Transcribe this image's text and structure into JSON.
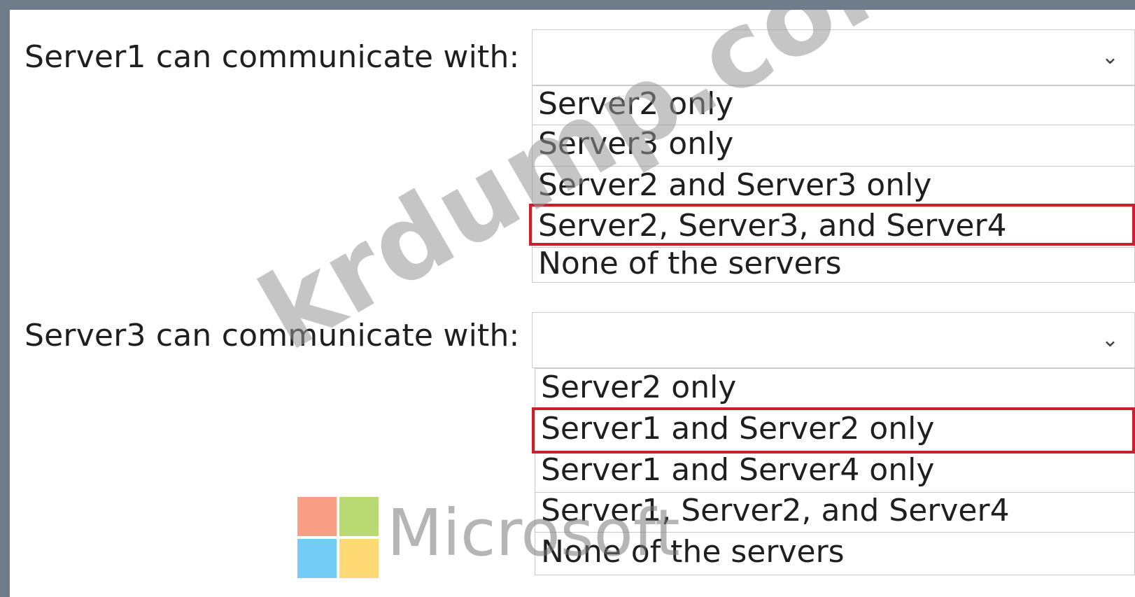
{
  "questions": [
    {
      "label": "Server1 can communicate with:",
      "selected_value": "",
      "options": [
        "Server2 only",
        "Server3 only",
        "Server2 and Server3 only",
        "Server2, Server3, and Server4",
        "None of the servers"
      ],
      "highlighted_option": "Server2, Server3, and Server4"
    },
    {
      "label": "Server3 can communicate with:",
      "selected_value": "",
      "options": [
        "Server2 only",
        "Server1 and Server2 only",
        "Server1 and Server4 only",
        "Server1, Server2, and Server4",
        "None of the servers"
      ],
      "highlighted_option": "Server1 and Server2 only"
    }
  ],
  "icons": {
    "dropdown": "chevron-down-icon"
  },
  "colors": {
    "highlight_border": "#c8202c",
    "window_border": "#6f7d8a"
  },
  "watermark": {
    "text": "krdump.com"
  },
  "logo": {
    "word": "Microsoft",
    "colors": [
      "#f25022",
      "#7fba00",
      "#00a4ef",
      "#ffb900"
    ]
  }
}
